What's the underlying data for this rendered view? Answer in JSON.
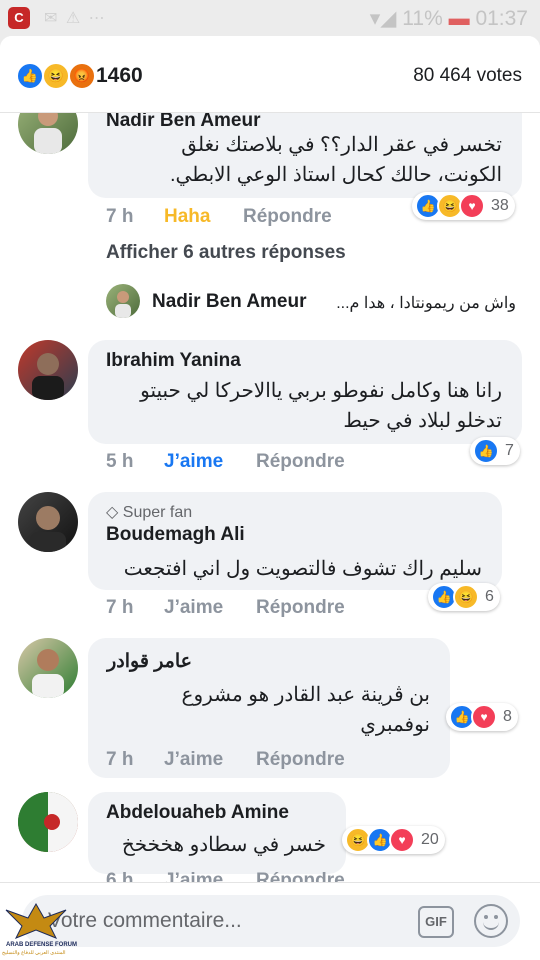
{
  "status_bar": {
    "app_icon": "C",
    "dim_icons": "✉ ⚠ ⋯",
    "signal": "▾◢",
    "battery": "11%",
    "time": "01:37"
  },
  "reaction_summary": {
    "icons": [
      "like",
      "haha",
      "angry"
    ],
    "count": "1460",
    "votes": "80 464 votes"
  },
  "comments": [
    {
      "name": "Nadir Ben Ameur",
      "text_lines": [
        "تخسر في عقر الدار؟؟ في بلاصتك نغلق",
        "الكونت، حالك كحال استاذ الوعي الابطي."
      ],
      "time": "7 h",
      "react_label": "Haha",
      "reply_label": "Répondre",
      "reactions": [
        "like",
        "haha",
        "love"
      ],
      "reaction_count": "38"
    },
    {
      "name": "Ibrahim Yanina",
      "text_lines": [
        "رانا هنا وكامل نفوطو بربي ياالاحركا لي حبيتو",
        "تدخلو لبلاد في حيط"
      ],
      "time": "5 h",
      "react_label": "J’aime",
      "reply_label": "Répondre",
      "reactions": [
        "like"
      ],
      "reaction_count": "7"
    },
    {
      "badge": "Super fan",
      "name": "Boudemagh Ali",
      "text_lines": [
        "سليم راك تشوف فالتصويت ول اني افتجعت"
      ],
      "time": "7 h",
      "react_label": "J’aime",
      "reply_label": "Répondre",
      "reactions": [
        "like",
        "haha"
      ],
      "reaction_count": "6"
    },
    {
      "name": "عامر قوادر",
      "text_lines": [
        "بن ڤرينة عبد القادر هو مشروع",
        "نوفمبري"
      ],
      "time": "7 h",
      "react_label": "J’aime",
      "reply_label": "Répondre",
      "reactions": [
        "like",
        "love"
      ],
      "reaction_count": "8"
    },
    {
      "name": "Abdelouaheb Amine",
      "text_lines": [
        "خسر في سطادو هخخخخ"
      ],
      "time": "6 h",
      "react_label": "J’aime",
      "reply_label": "Répondre",
      "reactions": [
        "haha",
        "like",
        "love"
      ],
      "reaction_count": "20"
    }
  ],
  "more_replies": "Afficher 6 autres réponses",
  "reply_preview": {
    "name": "Nadir Ben Ameur",
    "text": "واش من ريمونتادا ، هدا م..."
  },
  "composer": {
    "placeholder": "Votre commentaire...",
    "gif_label": "GIF"
  },
  "watermark": {
    "line1": "ARAB DEFENSE FORUM",
    "line2": "المنتدى العربي للدفاع والتسليح"
  },
  "colors": {
    "like": "#1877f2",
    "haha": "#f7b928",
    "love": "#f33e58",
    "angry": "#e9710f"
  }
}
